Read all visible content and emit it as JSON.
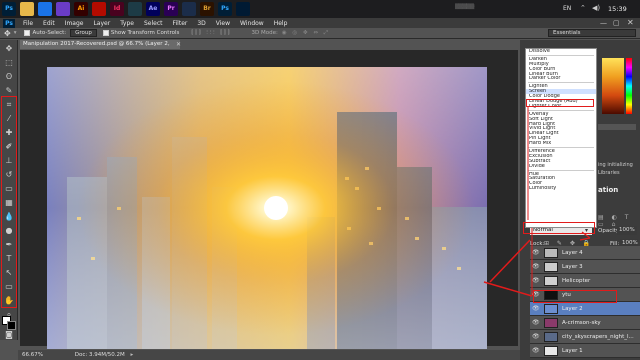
{
  "taskbar": {
    "lang": "EN",
    "clock": "15:39",
    "apps": [
      {
        "name": "photoshop-app-icon",
        "label": "Ps",
        "color": "#001e36",
        "fg": "#31a8ff"
      },
      {
        "name": "folder-app-icon",
        "label": "",
        "color": "#e8b84a",
        "fg": "#e8b84a"
      },
      {
        "name": "chrome-app-icon",
        "label": "",
        "color": "#1a73e8",
        "fg": "#fff"
      },
      {
        "name": "media-app-icon",
        "label": "",
        "color": "#6a3cc7",
        "fg": "#fff"
      },
      {
        "name": "illustrator-app-icon",
        "label": "Ai",
        "color": "#330000",
        "fg": "#ff9a00"
      },
      {
        "name": "acrobat-app-icon",
        "label": "",
        "color": "#b30b00",
        "fg": "#fff"
      },
      {
        "name": "indesign-app-icon",
        "label": "Id",
        "color": "#49021f",
        "fg": "#ff3366"
      },
      {
        "name": "audition-app-icon",
        "label": "",
        "color": "#1d3b46",
        "fg": "#9fe"
      },
      {
        "name": "aftereffects-app-icon",
        "label": "Ae",
        "color": "#00005b",
        "fg": "#9999ff"
      },
      {
        "name": "premiere-app-icon",
        "label": "Pr",
        "color": "#2a0055",
        "fg": "#ea77ff"
      },
      {
        "name": "media-encoder-app-icon",
        "label": "",
        "color": "#1b2d4a",
        "fg": "#8ad"
      },
      {
        "name": "bridge-app-icon",
        "label": "Br",
        "color": "#2b1200",
        "fg": "#e0a030"
      },
      {
        "name": "photoshop-app-icon-2",
        "label": "Ps",
        "color": "#001e36",
        "fg": "#31a8ff"
      },
      {
        "name": "lightroom-app-icon",
        "label": "",
        "color": "#001a33",
        "fg": "#31a8ff"
      }
    ]
  },
  "menubar": {
    "logo": "Ps",
    "items": [
      "File",
      "Edit",
      "Image",
      "Layer",
      "Type",
      "Select",
      "Filter",
      "3D",
      "View",
      "Window",
      "Help"
    ]
  },
  "optionsbar": {
    "auto_select_label": "Auto-Select:",
    "auto_select_value": "Group",
    "show_transform_label": "Show Transform Controls",
    "mode_3d_label": "3D Mode:",
    "workspace": "Essentials"
  },
  "document": {
    "tab_title": "Manipulation 2017-Recovered.psd @ 66.7% (Layer 2, RGB/8) *",
    "zoom": "66.67%",
    "doc_info": "Doc: 3.94M/50.2M"
  },
  "blend_modes": {
    "groups": [
      [
        "Dissolve"
      ],
      [
        "Darken",
        "Multiply",
        "Color Burn",
        "Linear Burn",
        "Darker Color"
      ],
      [
        "Lighten",
        "Screen",
        "Color Dodge",
        "Linear Dodge (Add)",
        "Lighter Color"
      ],
      [
        "Overlay",
        "Soft Light",
        "Hard Light",
        "Vivid Light",
        "Linear Light",
        "Pin Light",
        "Hard Mix"
      ],
      [
        "Difference",
        "Exclusion",
        "Subtract",
        "Divide"
      ],
      [
        "Hue",
        "Saturation",
        "Color",
        "Luminosity"
      ]
    ],
    "highlighted": "Screen"
  },
  "layers_panel": {
    "blend_value": "Normal",
    "opacity_label": "Opacity:",
    "opacity_value": "100%",
    "fill_label": "Fill:",
    "fill_value": "100%",
    "lock_label": "Lock:",
    "layers": [
      {
        "name": "Layer 4",
        "thumb": "#bbbbbb",
        "selected": false
      },
      {
        "name": "Layer 3",
        "thumb": "#cccccc",
        "selected": false
      },
      {
        "name": "Helicopter",
        "thumb": "#d0d0d0",
        "selected": false
      },
      {
        "name": "ytu",
        "thumb": "#111111",
        "selected": false
      },
      {
        "name": "Layer 2",
        "thumb": "#6d8fd0",
        "selected": true
      },
      {
        "name": "A-crimson-sky",
        "thumb": "#8a3a6a",
        "selected": false
      },
      {
        "name": "city_skyscrapers_night_l...",
        "thumb": "#5a6a88",
        "selected": false
      },
      {
        "name": "Layer 1",
        "thumb": "#e8e8e8",
        "selected": false
      }
    ]
  },
  "side_panel_text": {
    "line1": "ing initializing",
    "line2": "Libraries",
    "adjust_label": "ation"
  },
  "colors": {
    "accent_red": "#e11b1b",
    "selection_blue": "#5a7fc0"
  }
}
